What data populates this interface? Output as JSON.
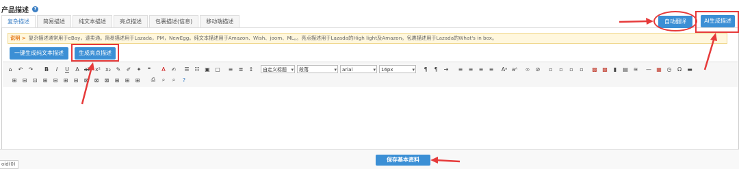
{
  "section": {
    "title": "产品描述",
    "help": "?"
  },
  "tabs": [
    {
      "label": "复杂描述"
    },
    {
      "label": "简易描述"
    },
    {
      "label": "纯文本描述"
    },
    {
      "label": "亮点描述"
    },
    {
      "label": "包裹描述(信息)"
    },
    {
      "label": "移动端描述"
    }
  ],
  "tip": {
    "label": "说明 >",
    "text": "复杂描述通常用于eBay，速卖通。简易描述用于Lazada，PM，NewEgg。纯文本描述用于Amazon、Wish、joom、ML。。亮点描述用于Lazada的High light及Amazon。包裹描述用于Lazada的What's in box。"
  },
  "buttons": {
    "auto_translate": "自动翻译",
    "ai_generate": "AI生成描述",
    "gen_plaintext": "一键生成纯文本描述",
    "gen_highlights": "生成亮点描述",
    "save_basic": "保存基本资料"
  },
  "toolbar": {
    "style_select": "自定义标题",
    "paragraph_select": "段落",
    "font_select": "arial",
    "size_select": "16px"
  },
  "status": {
    "text": "oid(0)"
  },
  "colors": {
    "accent": "#3b8fd5",
    "highlight": "#e63a3a",
    "tip_bg": "#fff7dd"
  }
}
